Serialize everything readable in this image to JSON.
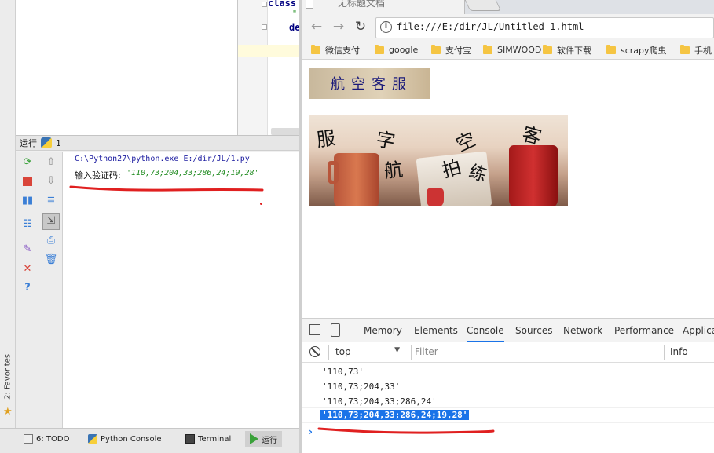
{
  "editor": {
    "code_keyword_class": "class",
    "code_quote": "\"",
    "code_keyword_def": "de"
  },
  "run_panel": {
    "title": "运行",
    "run_number": "1",
    "command": "C:\\Python27\\python.exe E:/dir/JL/1.py",
    "prompt_label": "输入验证码:",
    "input_value": "'110,73;204,33;286,24;19,28'"
  },
  "favorites": {
    "label": "2: Favorites"
  },
  "status_bar": {
    "tabs": [
      {
        "label": "6: TODO",
        "icon": "todo-icon"
      },
      {
        "label": "Python Console",
        "icon": "python-console-icon"
      },
      {
        "label": "Terminal",
        "icon": "terminal-icon"
      },
      {
        "label": "运行",
        "icon": "run-icon"
      }
    ]
  },
  "browser": {
    "tab_title": "无标题文档",
    "url": "file:///E:/dir/JL/Untitled-1.html",
    "bookmarks": [
      "微信支付",
      "google",
      "支付宝",
      "SIMWOOD",
      "软件下载",
      "scrapy爬虫",
      "手机"
    ]
  },
  "page": {
    "button_text": "航空客服",
    "captcha_chars": [
      "服",
      "字",
      "空",
      "客",
      "航",
      "拍",
      "练"
    ]
  },
  "devtools": {
    "tabs": [
      "Memory",
      "Elements",
      "Console",
      "Sources",
      "Network",
      "Performance",
      "Applica"
    ],
    "active_tab": "Console",
    "context": "top",
    "filter_placeholder": "Filter",
    "level": "Info",
    "logs": [
      "'110,73'",
      "'110,73;204,33'",
      "'110,73;204,33;286,24'",
      "'110,73;204,33;286,24;19,28'"
    ],
    "prompt_symbol": "›"
  },
  "colors": {
    "accent": "#1a73e8",
    "annotation_red": "#e02020",
    "console_green": "#1e8a1e"
  }
}
